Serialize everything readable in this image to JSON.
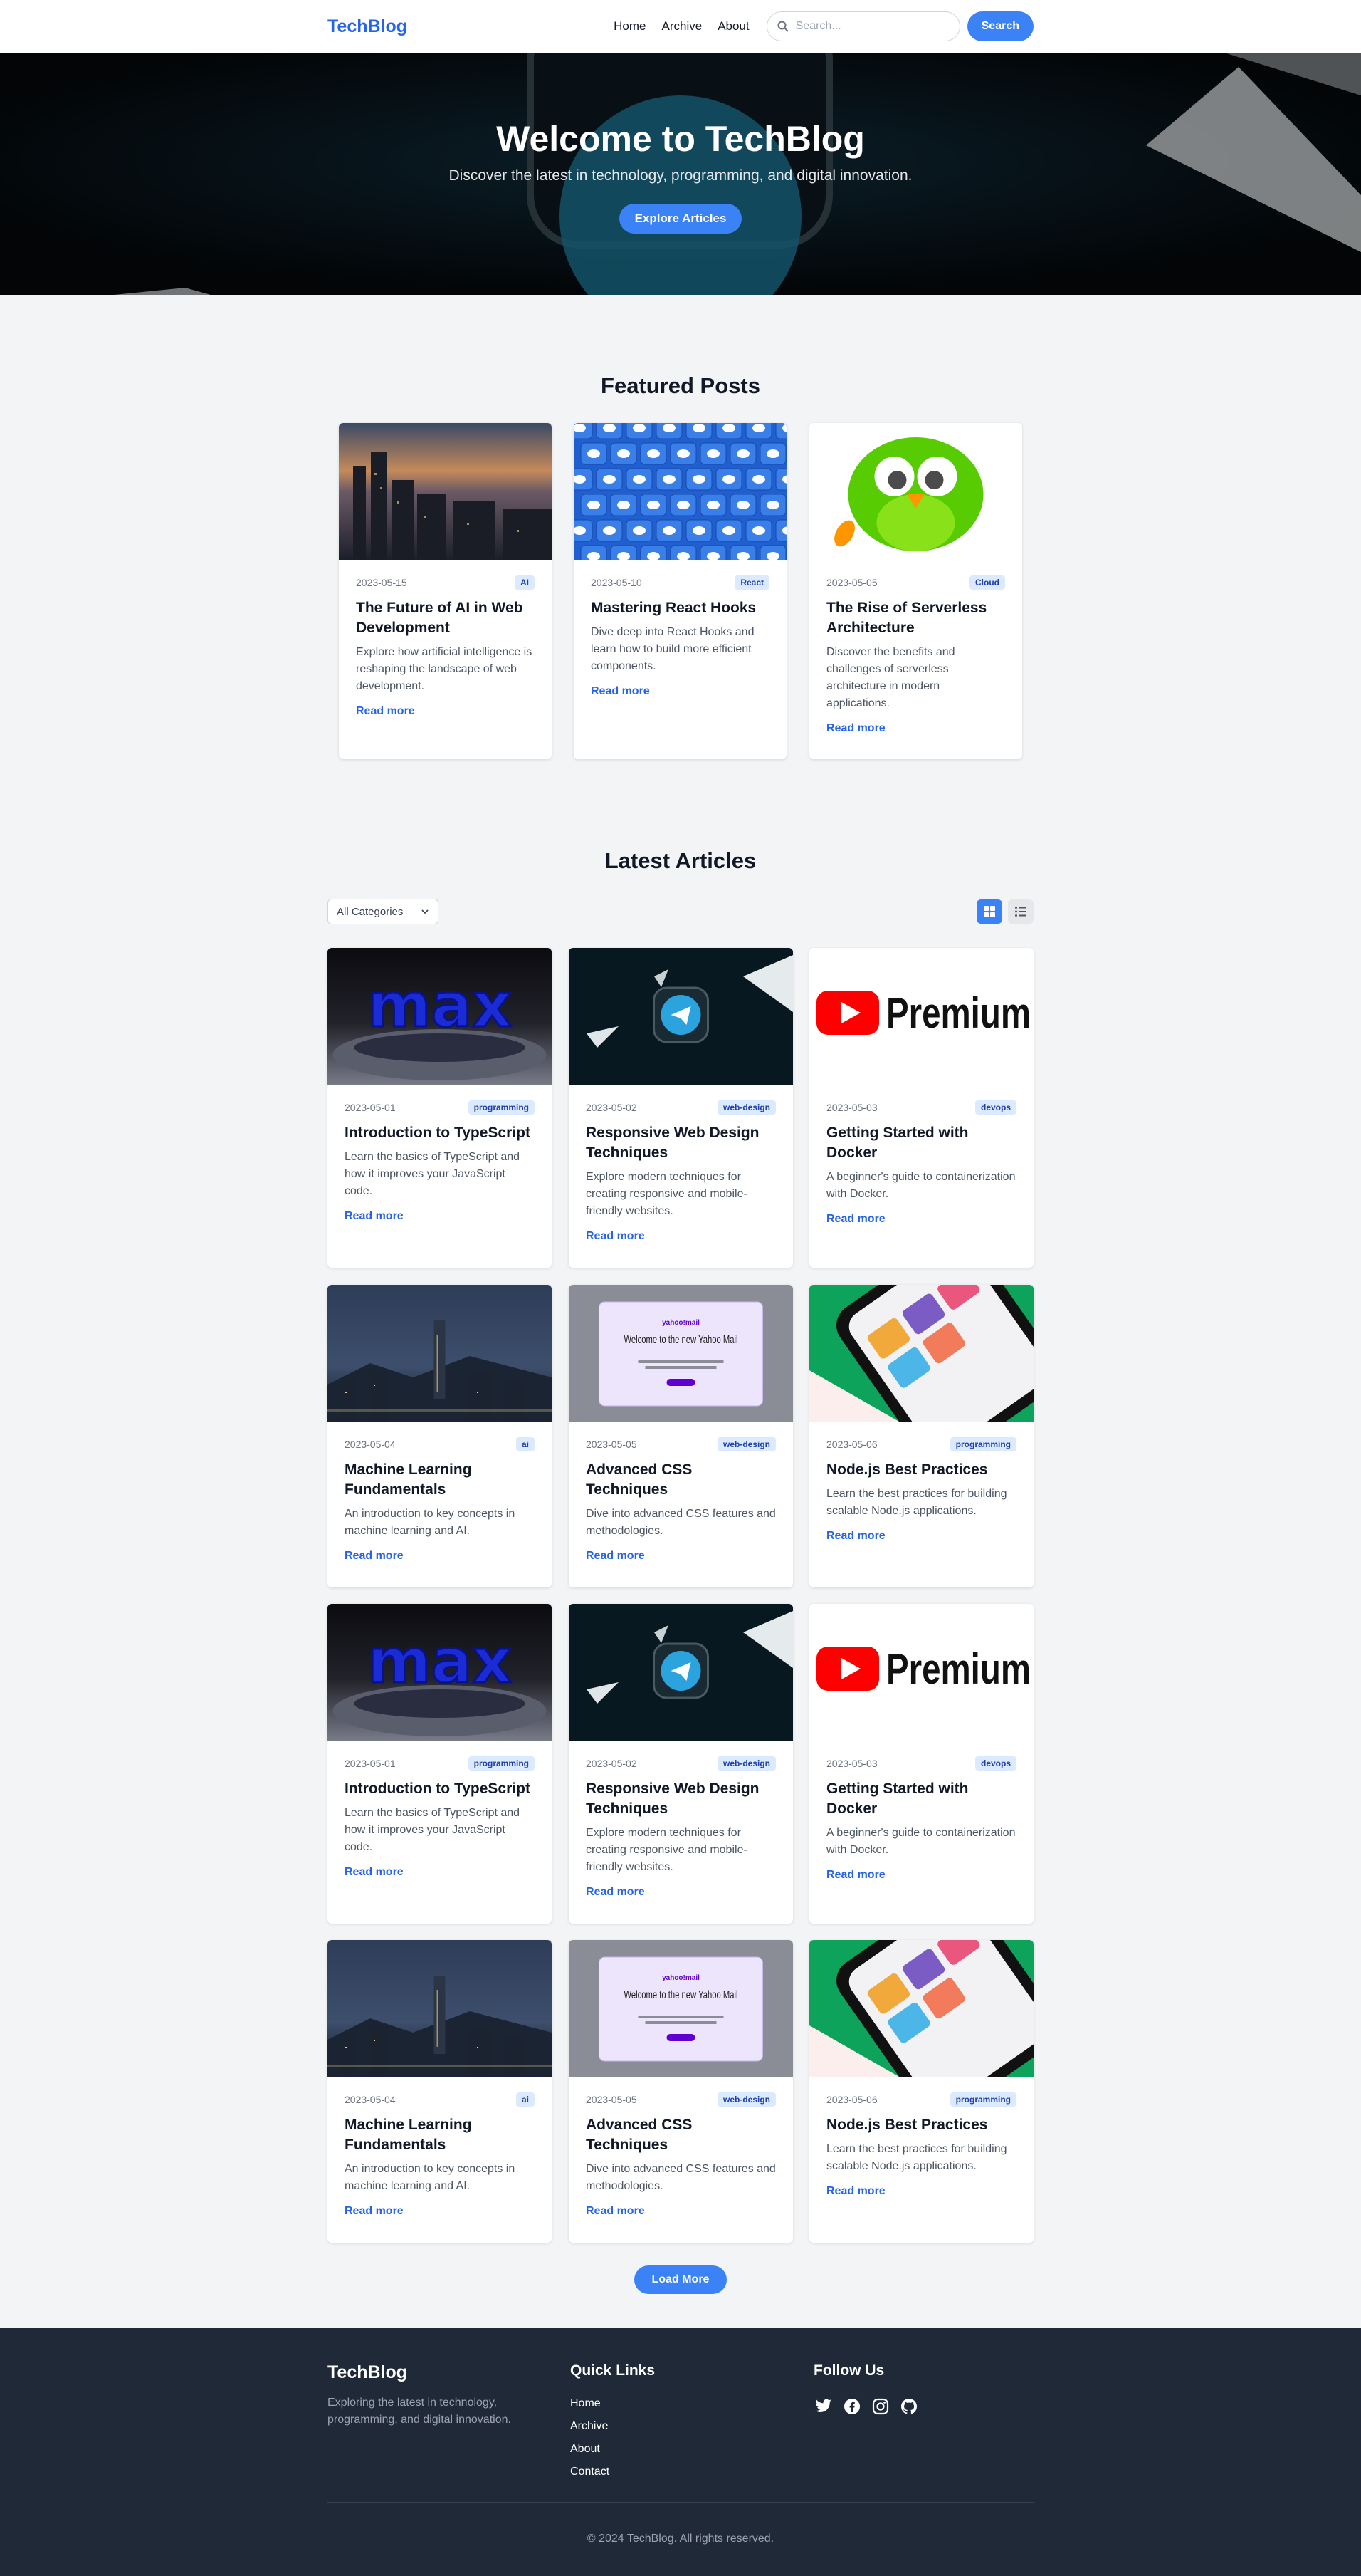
{
  "nav": {
    "logo": "TechBlog",
    "links": [
      "Home",
      "Archive",
      "About"
    ],
    "search_placeholder": "Search...",
    "search_button": "Search"
  },
  "hero": {
    "title": "Welcome to TechBlog",
    "subtitle": "Discover the latest in technology, programming, and digital innovation.",
    "button": "Explore Articles"
  },
  "featured": {
    "title": "Featured Posts",
    "read_more": "Read more",
    "posts": [
      {
        "date": "2023-05-15",
        "tag": "AI",
        "title": "The Future of AI in Web Development",
        "desc": "Explore how artificial intelligence is reshaping the landscape of web development.",
        "image": "city-sunset"
      },
      {
        "date": "2023-05-10",
        "tag": "React",
        "title": "Mastering React Hooks",
        "desc": "Dive deep into React Hooks and learn how to build more efficient components.",
        "image": "twitter-pattern"
      },
      {
        "date": "2023-05-05",
        "tag": "Cloud",
        "title": "The Rise of Serverless Architecture",
        "desc": "Discover the benefits and challenges of serverless architecture in modern applications.",
        "image": "duolingo-owl"
      }
    ]
  },
  "latest": {
    "title": "Latest Articles",
    "filter": "All Categories",
    "read_more": "Read more",
    "load_more": "Load More",
    "articles": [
      {
        "date": "2023-05-01",
        "tag": "programming",
        "title": "Introduction to TypeScript",
        "desc": "Learn the basics of TypeScript and how it improves your JavaScript code.",
        "image": "max-logo"
      },
      {
        "date": "2023-05-02",
        "tag": "web-design",
        "title": "Responsive Web Design Techniques",
        "desc": "Explore modern techniques for creating responsive and mobile-friendly websites.",
        "image": "telegram"
      },
      {
        "date": "2023-05-03",
        "tag": "devops",
        "title": "Getting Started with Docker",
        "desc": "A beginner's guide to containerization with Docker.",
        "image": "youtube-premium"
      },
      {
        "date": "2023-05-04",
        "tag": "ai",
        "title": "Machine Learning Fundamentals",
        "desc": "An introduction to key concepts in machine learning and AI.",
        "image": "city-night"
      },
      {
        "date": "2023-05-05",
        "tag": "web-design",
        "title": "Advanced CSS Techniques",
        "desc": "Dive into advanced CSS features and methodologies.",
        "image": "yahoo-mail"
      },
      {
        "date": "2023-05-06",
        "tag": "programming",
        "title": "Node.js Best Practices",
        "desc": "Learn the best practices for building scalable Node.js applications.",
        "image": "phone-app"
      },
      {
        "date": "2023-05-01",
        "tag": "programming",
        "title": "Introduction to TypeScript",
        "desc": "Learn the basics of TypeScript and how it improves your JavaScript code.",
        "image": "max-logo"
      },
      {
        "date": "2023-05-02",
        "tag": "web-design",
        "title": "Responsive Web Design Techniques",
        "desc": "Explore modern techniques for creating responsive and mobile-friendly websites.",
        "image": "telegram"
      },
      {
        "date": "2023-05-03",
        "tag": "devops",
        "title": "Getting Started with Docker",
        "desc": "A beginner's guide to containerization with Docker.",
        "image": "youtube-premium"
      },
      {
        "date": "2023-05-04",
        "tag": "ai",
        "title": "Machine Learning Fundamentals",
        "desc": "An introduction to key concepts in machine learning and AI.",
        "image": "city-night"
      },
      {
        "date": "2023-05-05",
        "tag": "web-design",
        "title": "Advanced CSS Techniques",
        "desc": "Dive into advanced CSS features and methodologies.",
        "image": "yahoo-mail"
      },
      {
        "date": "2023-05-06",
        "tag": "programming",
        "title": "Node.js Best Practices",
        "desc": "Learn the best practices for building scalable Node.js applications.",
        "image": "phone-app"
      }
    ]
  },
  "images": {
    "max_logo_text": "max",
    "premium_text": "Premium",
    "yahoo_brand": "yahoo!mail",
    "yahoo_headline": "Welcome to the new Yahoo Mail"
  },
  "footer": {
    "brand": "TechBlog",
    "desc": "Exploring the latest in technology, programming, and digital innovation.",
    "quick_links_title": "Quick Links",
    "quick_links": [
      "Home",
      "Archive",
      "About",
      "Contact"
    ],
    "follow_title": "Follow Us",
    "socials": [
      "twitter-icon",
      "facebook-icon",
      "instagram-icon",
      "github-icon"
    ],
    "copyright": "© 2024 TechBlog. All rights reserved."
  },
  "colors": {
    "accent": "#3b82f6",
    "brand": "#2563eb",
    "tag_bg": "#dbeafe",
    "footer_bg": "#1f2937"
  }
}
